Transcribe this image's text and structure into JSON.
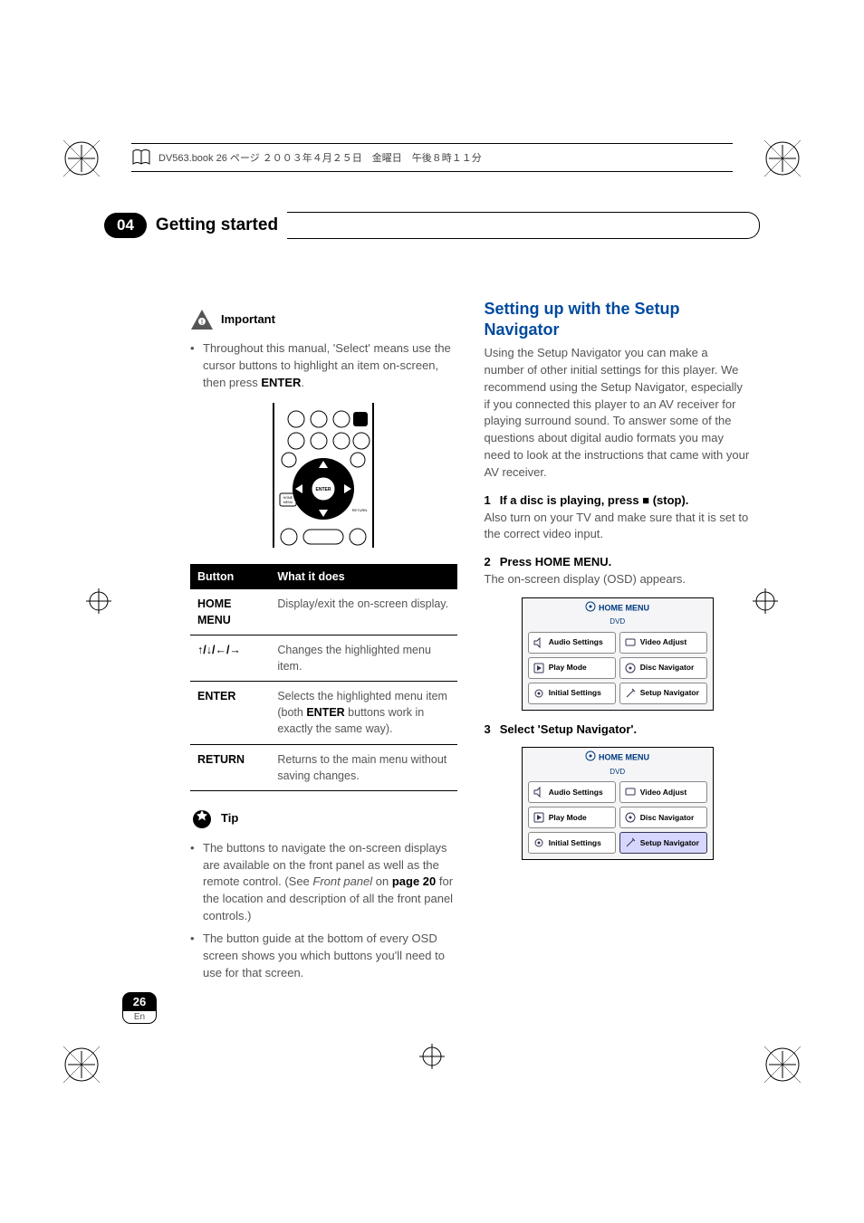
{
  "topbar": {
    "text": "DV563.book 26 ページ ２００３年４月２５日　金曜日　午後８時１１分"
  },
  "chapter": {
    "number": "04",
    "title": "Getting started"
  },
  "col_left": {
    "important_label": "Important",
    "important_text_pre": "Throughout this manual, 'Select' means use the cursor buttons to highlight an item on-screen, then press ",
    "important_text_enter": "ENTER",
    "important_text_post": ".",
    "table": {
      "head_button": "Button",
      "head_what": "What it does",
      "rows": [
        {
          "btn": "HOME MENU",
          "desc": "Display/exit the on-screen display."
        },
        {
          "btn": "↑/↓/←/→",
          "desc": "Changes the highlighted menu item."
        },
        {
          "btn": "ENTER",
          "desc_pre": "Selects the highlighted menu item (both ",
          "desc_b": "ENTER",
          "desc_post": " buttons work in exactly the same way)."
        },
        {
          "btn": "RETURN",
          "desc": "Returns to the main menu without saving changes."
        }
      ]
    },
    "tip_label": "Tip",
    "tip1_pre": "The buttons to navigate the on-screen displays are available on the front panel as well as the remote control. (See ",
    "tip1_i": "Front panel",
    "tip1_mid": " on ",
    "tip1_b": "page 20",
    "tip1_post": " for the location and description of all the front panel controls.)",
    "tip2": "The button guide at the bottom of every OSD screen shows you which buttons you'll need to use for that screen."
  },
  "col_right": {
    "title": "Setting up with the Setup Navigator",
    "intro": "Using the Setup Navigator you can make a number of other initial settings for this player. We recommend using the Setup Navigator, especially if you connected this player to an AV receiver for playing surround sound. To answer some of the questions about digital audio formats you may need to look at the instructions that came with your AV receiver.",
    "step1_head": "If a disc is playing, press ■ (stop).",
    "step1_body": "Also turn on your TV and make sure that it is set to the correct video input.",
    "step2_head": "Press HOME MENU.",
    "step2_body": "The on-screen display (OSD) appears.",
    "step3_head": "Select 'Setup Navigator'.",
    "menu": {
      "title": "HOME MENU",
      "sub": "DVD",
      "cells": [
        "Audio Settings",
        "Video Adjust",
        "Play Mode",
        "Disc Navigator",
        "Initial Settings",
        "Setup Navigator"
      ]
    }
  },
  "page_number": "26",
  "page_lang": "En",
  "remote_labels": {
    "enter": "ENTER",
    "return": "RETURN",
    "home": "HOME MENU"
  }
}
